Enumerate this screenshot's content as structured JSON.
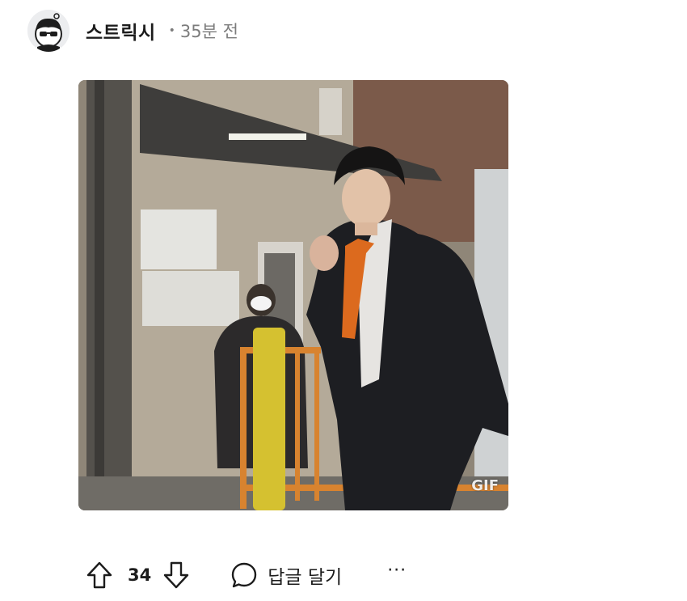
{
  "comment": {
    "username": "스트릭시",
    "separator": "•",
    "timestamp": "35분 전"
  },
  "media": {
    "badge": "GIF"
  },
  "actions": {
    "upvote_icon": "arrow-up-icon",
    "vote_count": "34",
    "downvote_icon": "arrow-down-icon",
    "reply_icon": "speech-bubble-icon",
    "reply_label": "답글 달기",
    "more_label": "···"
  }
}
